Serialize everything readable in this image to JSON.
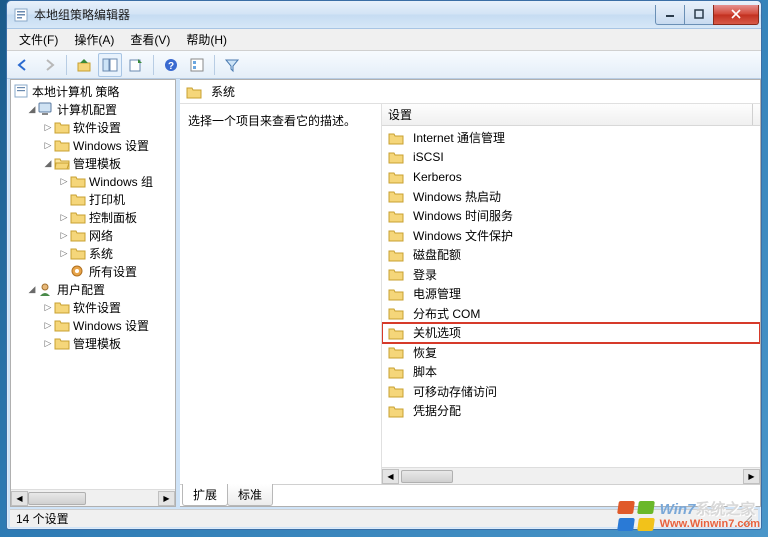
{
  "window": {
    "title": "本地组策略编辑器"
  },
  "menu": {
    "file": "文件(F)",
    "action": "操作(A)",
    "view": "查看(V)",
    "help": "帮助(H)"
  },
  "tree": {
    "root": "本地计算机 策略",
    "computer": "计算机配置",
    "software1": "软件设置",
    "winset1": "Windows 设置",
    "admtpl1": "管理模板",
    "wincomp": "Windows 组",
    "printer": "打印机",
    "ctrlpanel": "控制面板",
    "network": "网络",
    "system": "系统",
    "allset": "所有设置",
    "user": "用户配置",
    "software2": "软件设置",
    "winset2": "Windows 设置",
    "admtpl2": "管理模板"
  },
  "right": {
    "heading": "系统",
    "desc": "选择一个项目来查看它的描述。",
    "col_setting": "设置"
  },
  "items": [
    "Internet 通信管理",
    "iSCSI",
    "Kerberos",
    "Windows 热启动",
    "Windows 时间服务",
    "Windows 文件保护",
    "磁盘配额",
    "登录",
    "电源管理",
    "分布式 COM",
    "关机选项",
    "恢复",
    "脚本",
    "可移动存储访问",
    "凭据分配"
  ],
  "highlighted_index": 10,
  "tabs": {
    "ext": "扩展",
    "std": "标准"
  },
  "status": {
    "count": "14 个设置"
  },
  "watermark": {
    "line1a": "Win7",
    "line1b": "系统之家",
    "line2": "Www.Winwin7.com"
  }
}
